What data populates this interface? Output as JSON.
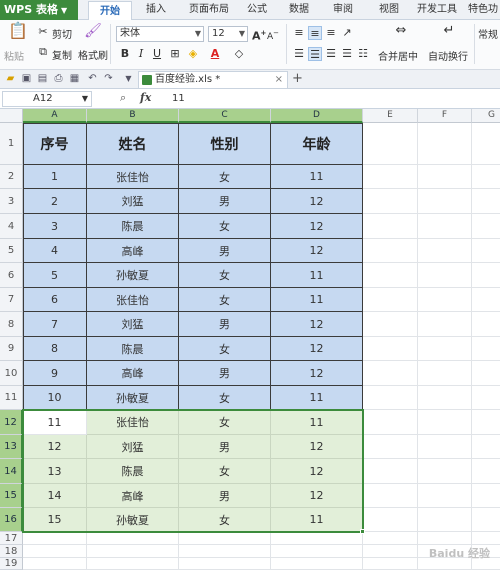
{
  "app": {
    "name": "WPS 表格"
  },
  "menu": {
    "tabs": [
      "开始",
      "插入",
      "页面布局",
      "公式",
      "数据",
      "审阅",
      "视图",
      "开发工具",
      "特色功"
    ],
    "active": "开始"
  },
  "ribbon": {
    "paste": "粘贴",
    "cut": "剪切",
    "copy": "复制",
    "format_painter": "格式刷",
    "font_name": "宋体",
    "font_size": "12",
    "merge_center": "合并居中",
    "auto_wrap": "自动换行",
    "number_format": "常规",
    "bold": "B",
    "italic": "I",
    "underline": "U",
    "grow_font": "A",
    "shrink_font": "A"
  },
  "quickbar": {
    "file_tab": "百度经验.xls *",
    "add_tab": "+"
  },
  "formula_bar": {
    "cell_ref": "A12",
    "fx": "fx",
    "value": "11"
  },
  "columns": [
    "A",
    "B",
    "C",
    "D",
    "E",
    "F",
    "G"
  ],
  "rows": [
    "1",
    "2",
    "3",
    "4",
    "5",
    "6",
    "7",
    "8",
    "9",
    "10",
    "11",
    "12",
    "13",
    "14",
    "15",
    "16",
    "17",
    "18",
    "19"
  ],
  "table": {
    "headers": [
      "序号",
      "姓名",
      "性别",
      "年龄"
    ],
    "records": [
      [
        "1",
        "张佳怡",
        "女",
        "11"
      ],
      [
        "2",
        "刘猛",
        "男",
        "12"
      ],
      [
        "3",
        "陈晨",
        "女",
        "12"
      ],
      [
        "4",
        "高峰",
        "男",
        "12"
      ],
      [
        "5",
        "孙敏夏",
        "女",
        "11"
      ],
      [
        "6",
        "张佳怡",
        "女",
        "11"
      ],
      [
        "7",
        "刘猛",
        "男",
        "12"
      ],
      [
        "8",
        "陈晨",
        "女",
        "12"
      ],
      [
        "9",
        "高峰",
        "男",
        "12"
      ],
      [
        "10",
        "孙敏夏",
        "女",
        "11"
      ],
      [
        "11",
        "张佳怡",
        "女",
        "11"
      ],
      [
        "12",
        "刘猛",
        "男",
        "12"
      ],
      [
        "13",
        "陈晨",
        "女",
        "12"
      ],
      [
        "14",
        "高峰",
        "男",
        "12"
      ],
      [
        "15",
        "孙敏夏",
        "女",
        "11"
      ]
    ]
  },
  "selection": {
    "range": "A12:D16",
    "active_cell": "A12"
  },
  "watermark": "Baidu 经验",
  "colors": {
    "brand": "#3c8b3c",
    "table_fill": "#c6d9f1",
    "selection_fill": "#e2efd9",
    "selection_border": "#3c8b3c"
  }
}
